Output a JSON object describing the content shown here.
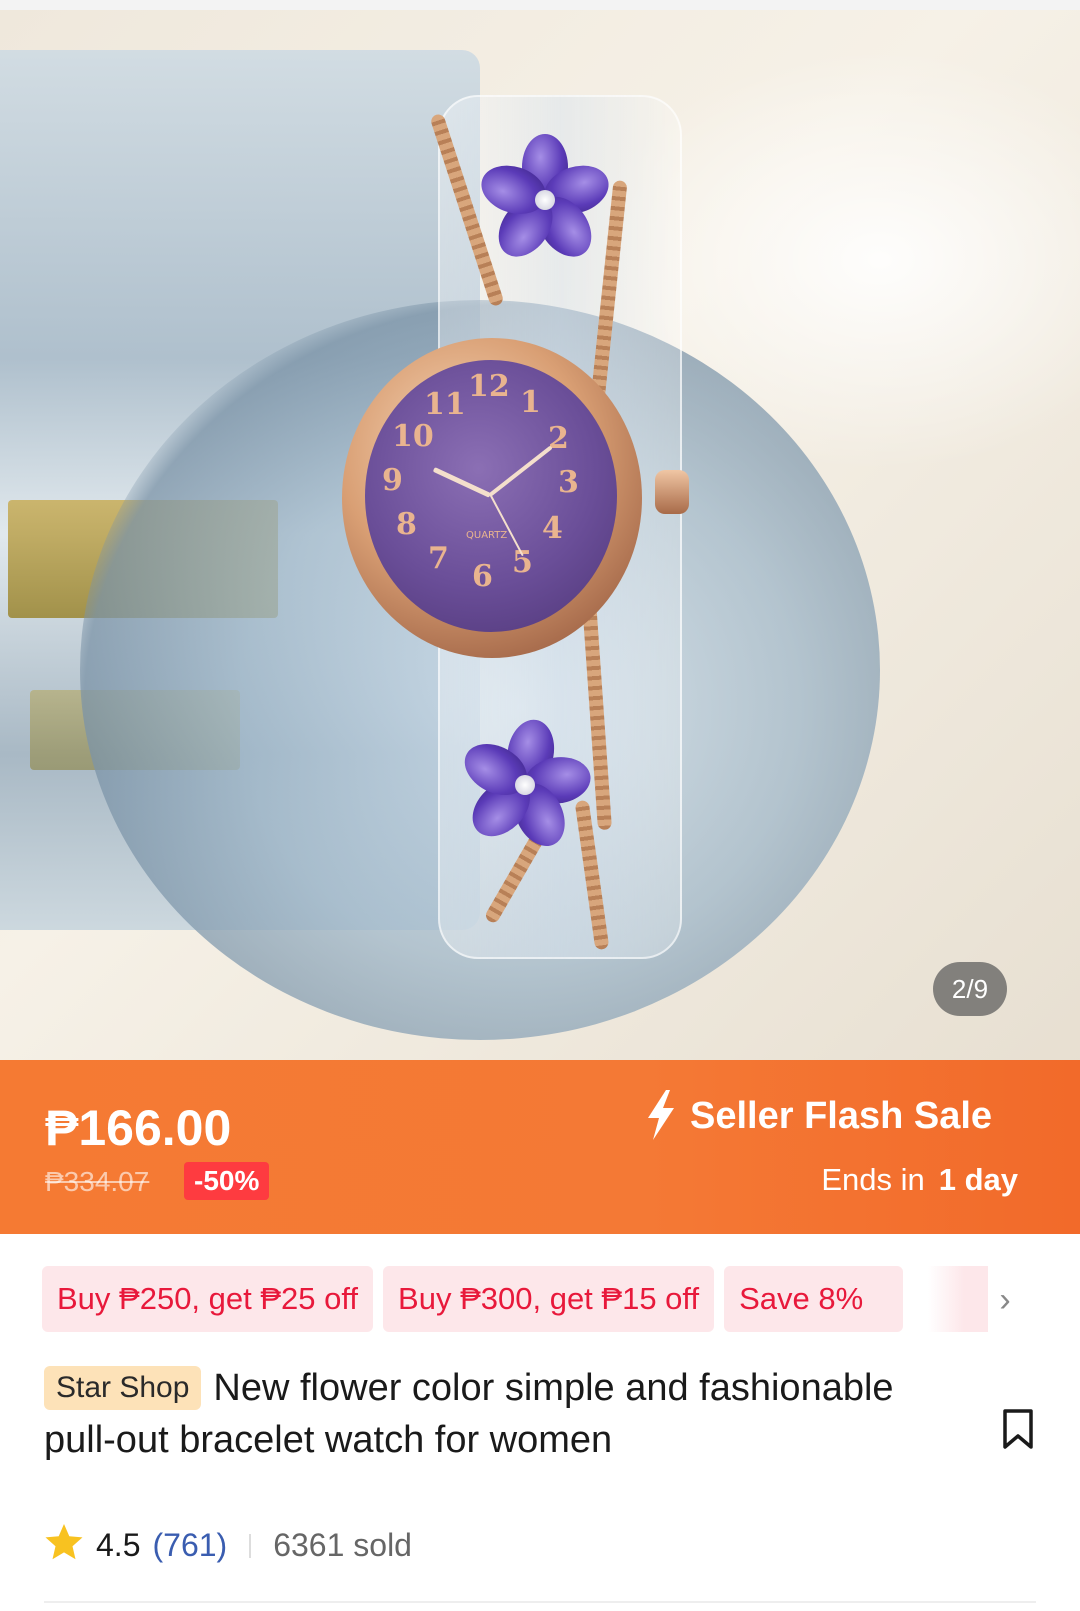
{
  "product_gallery": {
    "image_counter": "2/9",
    "watch_dial_numbers": [
      "12",
      "1",
      "2",
      "3",
      "4",
      "5",
      "6",
      "7",
      "8",
      "9",
      "10",
      "11"
    ],
    "dial_brand_text": "QUARTZ"
  },
  "flash_sale": {
    "current_price": "₱166.00",
    "original_price": "₱334.07",
    "discount": "-50%",
    "label": "Seller Flash Sale",
    "ends_prefix": "Ends in",
    "ends_value": "1 day",
    "banner_color": "#f47935"
  },
  "vouchers": [
    {
      "label": "Buy ₱250, get ₱25 off"
    },
    {
      "label": "Buy ₱300, get ₱15 off"
    },
    {
      "label": "Save 8%"
    }
  ],
  "product": {
    "shop_badge": "Star Shop",
    "title": "New flower color simple and fashionable pull-out bracelet watch for women",
    "rating": "4.5",
    "review_count": "(761)",
    "sold": "6361 sold"
  },
  "icons": {
    "flash": "lightning-icon",
    "chevron": "chevron-right-icon",
    "bookmark": "bookmark-icon",
    "star": "star-icon"
  }
}
